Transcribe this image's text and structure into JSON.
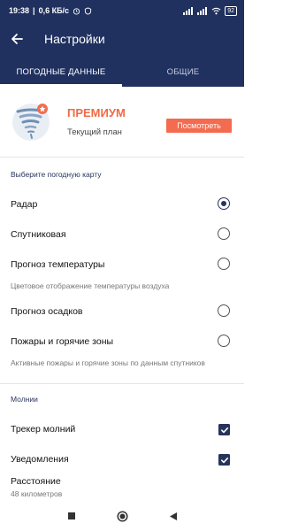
{
  "status_bar": {
    "time": "19:38",
    "speed": "0,6 КБ/с",
    "battery": "92"
  },
  "app_bar": {
    "title": "Настройки"
  },
  "tabs": [
    {
      "label": "ПОГОДНЫЕ ДАННЫЕ",
      "active": true
    },
    {
      "label": "ОБЩИЕ",
      "active": false
    }
  ],
  "premium": {
    "title": "ПРЕМИУМ",
    "subtitle": "Текущий план",
    "button_label": "Посмотреть"
  },
  "map_section": {
    "heading": "Выберите погодную карту",
    "options": [
      {
        "label": "Радар",
        "selected": true,
        "description": ""
      },
      {
        "label": "Спутниковая",
        "selected": false,
        "description": ""
      },
      {
        "label": "Прогноз температуры",
        "selected": false,
        "description": "Цветовое отображение температуры воздуха"
      },
      {
        "label": "Прогноз осадков",
        "selected": false,
        "description": ""
      },
      {
        "label": "Пожары и горячие зоны",
        "selected": false,
        "description": "Активные пожары и горячие зоны по данным спутников"
      }
    ]
  },
  "lightning_section": {
    "heading": "Молнии",
    "items": [
      {
        "label": "Трекер молний",
        "checked": true
      },
      {
        "label": "Уведомления",
        "checked": true
      }
    ],
    "distance": {
      "label": "Расстояние",
      "value": "48 километров"
    }
  },
  "colors": {
    "primary": "#20315f",
    "accent": "#f36c4f",
    "premium_text": "#ef6a45"
  },
  "icons": [
    "back-arrow-icon",
    "tornado-logo-icon",
    "star-badge-icon",
    "checkmark-icon",
    "nav-home-icon",
    "nav-back-icon",
    "nav-recents-icon"
  ]
}
